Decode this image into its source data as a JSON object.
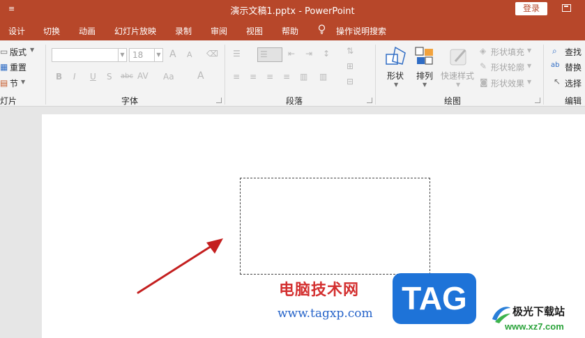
{
  "titlebar": {
    "quick_access": "≡",
    "title": "演示文稿1.pptx  -  PowerPoint",
    "login_label": "登录"
  },
  "menubar": {
    "tabs": [
      "设计",
      "切换",
      "动画",
      "幻灯片放映",
      "录制",
      "审阅",
      "视图",
      "帮助"
    ],
    "search_label": "操作说明搜索"
  },
  "ribbon": {
    "slides": {
      "layout": "版式",
      "reset": "重置",
      "section": "节",
      "label": "灯片"
    },
    "font": {
      "size": "18",
      "label": "字体",
      "bold": "B",
      "italic": "I",
      "underline": "U",
      "shadow": "S",
      "strike": "abc",
      "spacing": "AV",
      "case": "Aa",
      "grow": "A",
      "shrink": "A",
      "color": "A"
    },
    "paragraph": {
      "label": "段落"
    },
    "drawing": {
      "shape": "形状",
      "arrange": "排列",
      "quick_styles": "快速样式",
      "fill": "形状填充",
      "outline": "形状轮廓",
      "effects": "形状效果",
      "label": "绘图"
    },
    "editing": {
      "find": "查找",
      "replace": "替换",
      "select": "选择",
      "label": "编辑"
    }
  },
  "watermark": {
    "cn_site": "电脑技术网",
    "url": "www.tagxp.com",
    "tag": "TAG",
    "xz_name": "极光下载站",
    "xz_url": "www.xz7.com"
  },
  "colors": {
    "accent": "#b7472a",
    "annotation_arrow": "#c41f1f"
  }
}
